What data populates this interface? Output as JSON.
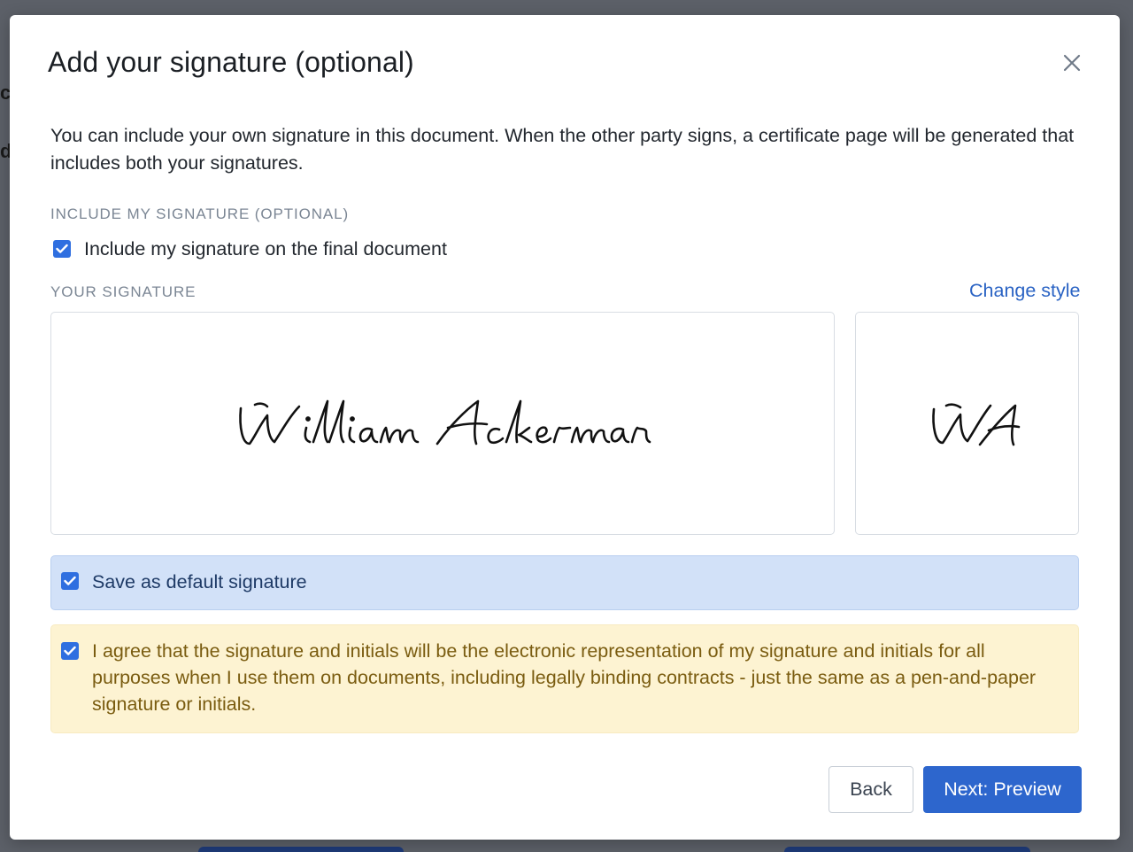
{
  "dialog": {
    "title": "Add your signature (optional)",
    "intro": "You can include your own signature in this document. When the other party signs, a certificate page will be generated that includes both your signatures."
  },
  "include_section": {
    "label": "INCLUDE MY SIGNATURE (OPTIONAL)",
    "checkbox_label": "Include my signature on the final document",
    "checked": true
  },
  "signature_section": {
    "label": "YOUR SIGNATURE",
    "change_style_link": "Change style",
    "full_signature": "William Ackerman",
    "initials": "WA"
  },
  "save_default": {
    "label": "Save as default signature",
    "checked": true
  },
  "agreement": {
    "text": "I agree that the signature and initials will be the electronic representation of my signature and initials for all purposes when I use them on documents, including legally binding contracts - just the same as a pen-and-paper signature or initials.",
    "checked": true
  },
  "footer": {
    "back_label": "Back",
    "next_label": "Next: Preview"
  },
  "colors": {
    "primary": "#2d66cd",
    "checkbox": "#2f6fe0",
    "info_bg": "#d2e1f8",
    "warning_bg": "#fdf3d2",
    "warning_text": "#7a5c10"
  },
  "icons": {
    "close": "close-icon",
    "check": "check-icon"
  }
}
